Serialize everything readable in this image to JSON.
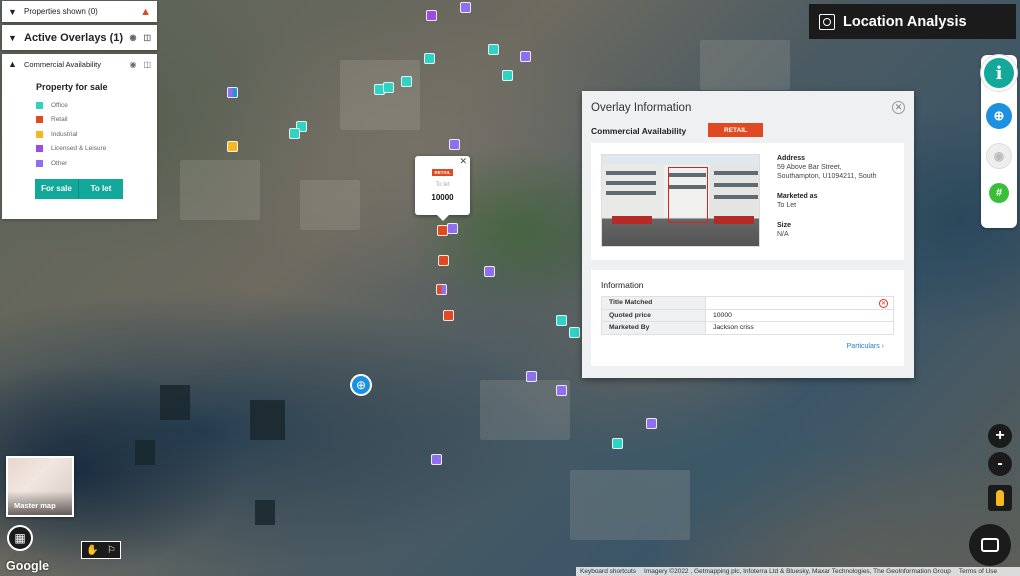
{
  "panels": {
    "properties_shown": "Properties shown (0)",
    "active_overlays": "Active Overlays (1)",
    "commercial_availability": "Commercial Availability"
  },
  "legend": {
    "title": "Property for sale",
    "items": [
      {
        "label": "Office",
        "color": "#2ed3c4"
      },
      {
        "label": "Retail",
        "color": "#e04a22"
      },
      {
        "label": "Industrial",
        "color": "#f4b822"
      },
      {
        "label": "Licensed & Leisure",
        "color": "#9a4de0"
      },
      {
        "label": "Other",
        "color": "#8d6ff0"
      }
    ],
    "for_sale": "For sale",
    "to_let": "To let"
  },
  "header": {
    "title": "Location Analysis"
  },
  "toolbar": {
    "icons": [
      "info-icon",
      "crosshair-icon",
      "eye-icon",
      "pin-icon"
    ]
  },
  "popup": {
    "tag": "RETAIL",
    "status": "To let",
    "value": "10000"
  },
  "info_panel": {
    "title": "Overlay Information",
    "layer": "Commercial Availability",
    "tag": "RETAIL",
    "address_label": "Address",
    "address": "59 Above Bar Street,",
    "address2": "Southampton, U1094211, South",
    "marketed_label": "Marketed as",
    "marketed": "To Let",
    "size_label": "Size",
    "size": "N/A",
    "info_title": "Information",
    "rows": [
      {
        "key": "Title Matched",
        "value": ""
      },
      {
        "key": "Quoted price",
        "value": "10000"
      },
      {
        "key": "Marketed By",
        "value": "Jackson criss"
      }
    ],
    "particulars": "Particulars"
  },
  "map_controls": {
    "zoom_in": "+",
    "zoom_out": "-",
    "master_map": "Master map",
    "google": "Google"
  },
  "footer": {
    "shortcuts": "Keyboard shortcuts",
    "imagery": "Imagery ©2022 , Getmapping plc, Infoterra Ltd & Bluesky, Maxar Technologies, The GeoInformation Group",
    "terms": "Terms of Use"
  }
}
